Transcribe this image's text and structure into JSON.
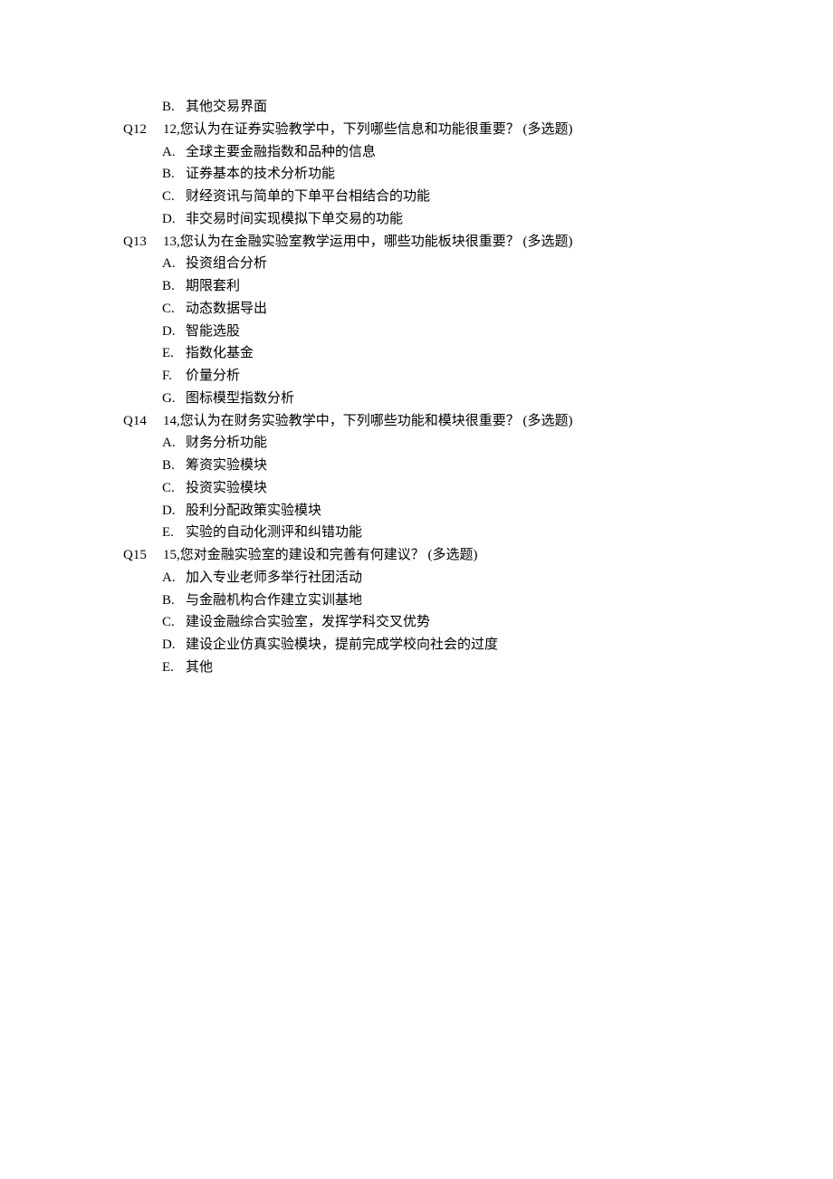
{
  "optionB_top": {
    "letter": "B.",
    "text": "其他交易界面"
  },
  "questions": [
    {
      "id": "Q12",
      "text": "12,您认为在证券实验教学中，下列哪些信息和功能很重要？   (多选题)",
      "options": [
        {
          "letter": "A.",
          "text": "全球主要金融指数和品种的信息"
        },
        {
          "letter": "B.",
          "text": "证券基本的技术分析功能"
        },
        {
          "letter": "C.",
          "text": "财经资讯与简单的下单平台相结合的功能"
        },
        {
          "letter": "D.",
          "text": "非交易时间实现模拟下单交易的功能"
        }
      ]
    },
    {
      "id": "Q13",
      "text": "13,您认为在金融实验室教学运用中，哪些功能板块很重要？   (多选题)",
      "options": [
        {
          "letter": "A.",
          "text": "投资组合分析"
        },
        {
          "letter": "B.",
          "text": "期限套利"
        },
        {
          "letter": "C.",
          "text": "动态数据导出"
        },
        {
          "letter": "D.",
          "text": "智能选股"
        },
        {
          "letter": "E.",
          "text": "指数化基金"
        },
        {
          "letter": "F.",
          "text": "价量分析"
        },
        {
          "letter": "G.",
          "text": "图标模型指数分析"
        }
      ]
    },
    {
      "id": "Q14",
      "text": "14,您认为在财务实验教学中，下列哪些功能和模块很重要？   (多选题)",
      "options": [
        {
          "letter": "A.",
          "text": "财务分析功能"
        },
        {
          "letter": "B.",
          "text": "筹资实验模块"
        },
        {
          "letter": "C.",
          "text": "投资实验模块"
        },
        {
          "letter": "D.",
          "text": "股利分配政策实验模块"
        },
        {
          "letter": "E.",
          "text": "实验的自动化测评和纠错功能"
        }
      ]
    },
    {
      "id": "Q15",
      "text": "15,您对金融实验室的建设和完善有何建议？   (多选题)",
      "options": [
        {
          "letter": "A.",
          "text": "加入专业老师多举行社团活动"
        },
        {
          "letter": "B.",
          "text": "与金融机构合作建立实训基地"
        },
        {
          "letter": "C.",
          "text": "建设金融综合实验室，发挥学科交叉优势"
        },
        {
          "letter": "D.",
          "text": "建设企业仿真实验模块，提前完成学校向社会的过度"
        },
        {
          "letter": "E.",
          "text": "其他"
        }
      ]
    }
  ]
}
